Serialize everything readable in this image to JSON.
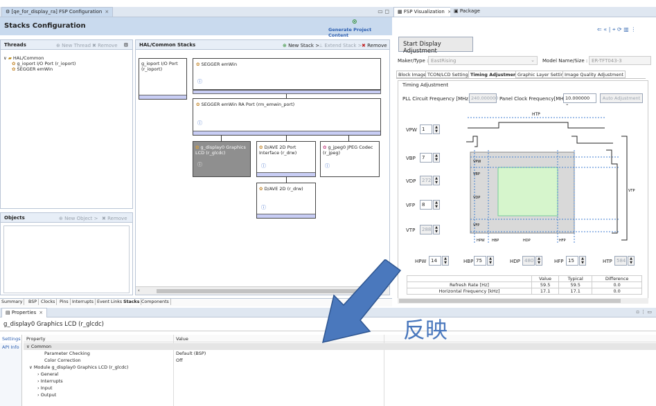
{
  "editor": {
    "tab_title": "[qe_for_display_ra] FSP Configuration",
    "title": "Stacks Configuration",
    "generate_label": "Generate Project Content",
    "threads_label": "Threads",
    "new_thread": "New Thread",
    "remove": "Remove",
    "tree": [
      "HAL/Common",
      "g_ioport I/O Port (r_ioport)",
      "SEGGER emWin"
    ],
    "hal_stacks_label": "HAL/Common Stacks",
    "new_stack": "New Stack >",
    "extend_stack": "Extend Stack >",
    "objects_label": "Objects",
    "new_object": "New Object >",
    "boxes": {
      "ioport": "g_ioport I/O Port\n(r_ioport)",
      "emwin": "SEGGER emWin",
      "emwin_ra": "SEGGER emWin RA Port (rm_emwin_port)",
      "display": "g_display0 Graphics\nLCD (r_glcdc)",
      "dave_port": "D/AVE 2D Port\nInterface (r_drw)",
      "jpeg": "g_jpeg0 JPEG Codec\n(r_jpeg)",
      "dave": "D/AVE 2D (r_drw)"
    },
    "info_glyph": "ⓘ",
    "bottom_tabs": [
      "Summary",
      "BSP",
      "Clocks",
      "Pins",
      "Interrupts",
      "Event Links",
      "Stacks",
      "Components"
    ]
  },
  "viz": {
    "tabs": [
      "FSP Visualization",
      "Package"
    ],
    "start_btn": "Start Display Adjustment",
    "maker_label": "Maker/Type :",
    "maker_value": "EastRising",
    "model_label": "Model Name/Size :",
    "model_value": "ER-TFT043-3",
    "subtabs": [
      "Block Image",
      "TCON/LCD Setting",
      "Timing Adjustment",
      "Graphic Layer Setting",
      "Image Quality Adjustment"
    ],
    "timing_group": "Timing Adjustment",
    "pll_label": "PLL Circuit Frequency [MHz] :",
    "pll_value": "240.000000",
    "panel_clk_label": "Panel Clock Frequency[MHz] :",
    "panel_clk_value": "10.000000",
    "auto_btn": "Auto Adjustment",
    "vfields": [
      {
        "label": "VPW",
        "value": "1"
      },
      {
        "label": "VBP",
        "value": "7"
      },
      {
        "label": "VDP",
        "value": "272"
      },
      {
        "label": "VFP",
        "value": "8"
      },
      {
        "label": "VTP",
        "value": "288"
      }
    ],
    "hfields": [
      {
        "label": "HPW",
        "value": "14"
      },
      {
        "label": "HBP",
        "value": "75"
      },
      {
        "label": "HDP",
        "value": "480"
      },
      {
        "label": "HFP",
        "value": "15"
      },
      {
        "label": "HTP",
        "value": "584"
      }
    ],
    "diagram_labels": {
      "htp": "HTP",
      "vpw": "VPW",
      "vbp": "VBP",
      "vdp": "VDP",
      "vfp": "VFP",
      "vtp": "VTP",
      "hpw": "HPW",
      "hbp": "HBP",
      "hdp": "HDP",
      "hfp": "HFP"
    },
    "table": {
      "headers": [
        "Value",
        "Typical",
        "Difference"
      ],
      "rows": [
        {
          "name": "Refresh Rate [Hz]",
          "value": "59.5",
          "typical": "59.5",
          "diff": "0.0"
        },
        {
          "name": "Horizontal Frequency [kHz]",
          "value": "17.1",
          "typical": "17.1",
          "diff": "0.0"
        }
      ]
    }
  },
  "properties": {
    "tab": "Properties",
    "title": "g_display0 Graphics LCD (r_glcdc)",
    "side_tabs": [
      "Settings",
      "API Info"
    ],
    "col_property": "Property",
    "col_value": "Value",
    "rows": [
      {
        "name": "Common",
        "value": ""
      },
      {
        "name": "Parameter Checking",
        "value": "Default (BSP)"
      },
      {
        "name": "Color Correction",
        "value": "Off"
      },
      {
        "name": "Module g_display0 Graphics LCD (r_glcdc)",
        "value": ""
      },
      {
        "name": "General",
        "value": ""
      },
      {
        "name": "Interrupts",
        "value": ""
      },
      {
        "name": "Input",
        "value": ""
      },
      {
        "name": "Output",
        "value": ""
      }
    ]
  },
  "overlay": {
    "text": "反映"
  },
  "colors": {
    "arrow": "#4a78bd",
    "header_bg": "#c9daee",
    "selected_box": "#8f8f8f",
    "green": "#d6f5cc"
  }
}
